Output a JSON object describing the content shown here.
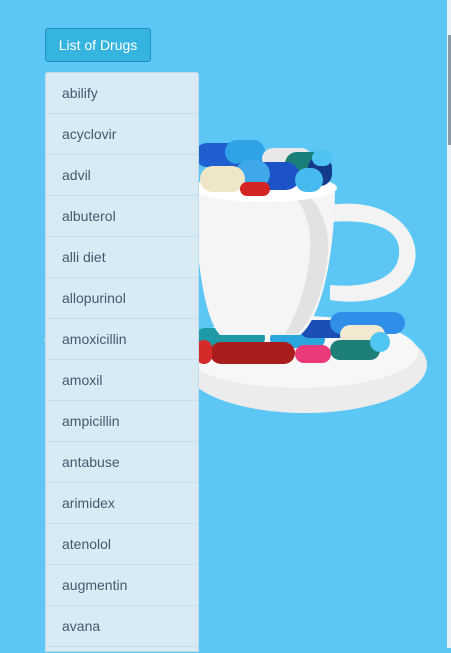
{
  "dropdown": {
    "button_label": "List of Drugs",
    "items": [
      "abilify",
      "acyclovir",
      "advil",
      "albuterol",
      "alli diet",
      "allopurinol",
      "amoxicillin",
      "amoxil",
      "ampicillin",
      "antabuse",
      "arimidex",
      "atenolol",
      "augmentin",
      "avana"
    ]
  },
  "colors": {
    "background": "#5cc7f5",
    "button": "#36b4e0",
    "menu": "#d8ebf5"
  },
  "images": {
    "hero": "cup-of-pills"
  }
}
